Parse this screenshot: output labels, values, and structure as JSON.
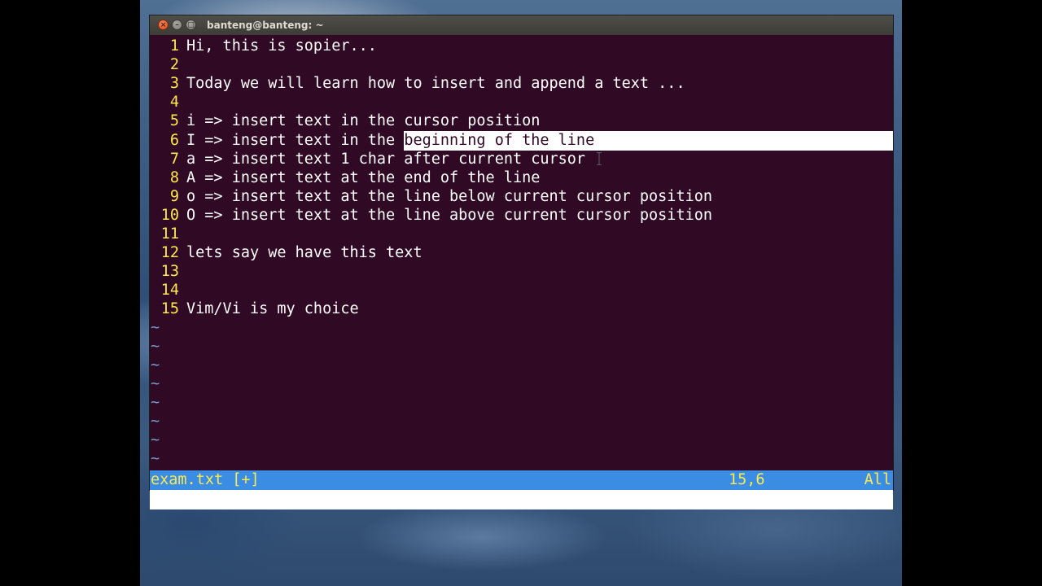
{
  "window": {
    "title": "banteng@banteng: ~",
    "buttons": {
      "close": "×",
      "minimize": "–",
      "maximize": "□"
    }
  },
  "editor": {
    "lines": [
      {
        "num": "1",
        "text": "Hi, this is sopier..."
      },
      {
        "num": "2",
        "text": ""
      },
      {
        "num": "3",
        "text": "Today we will learn how to insert and append a text ..."
      },
      {
        "num": "4",
        "text": ""
      },
      {
        "num": "5",
        "text": "i => insert text in the cursor position"
      },
      {
        "num": "6",
        "text_before": "I => insert text in the ",
        "text_selected": "beginning of the line"
      },
      {
        "num": "7",
        "text": "a => insert text 1 char after current cursor"
      },
      {
        "num": "8",
        "text": "A => insert text at the end of the line"
      },
      {
        "num": "9",
        "text": "o => insert text at the line below current cursor position"
      },
      {
        "num": "10",
        "text": "O => insert text at the line above current cursor position"
      },
      {
        "num": "11",
        "text": ""
      },
      {
        "num": "12",
        "text": "lets say we have this text"
      },
      {
        "num": "13",
        "text": ""
      },
      {
        "num": "14",
        "text": ""
      },
      {
        "num": "15",
        "text": "Vim/Vi is my choice"
      }
    ],
    "empty_marker": "~"
  },
  "status": {
    "filename": "exam.txt [+]",
    "position": "15,6",
    "scroll": "All"
  },
  "colors": {
    "terminal_bg": "#300a24",
    "line_number": "#fce94f",
    "tilde": "#729fcf",
    "status_bg": "#3a8de3",
    "status_fg": "#fce94f"
  }
}
